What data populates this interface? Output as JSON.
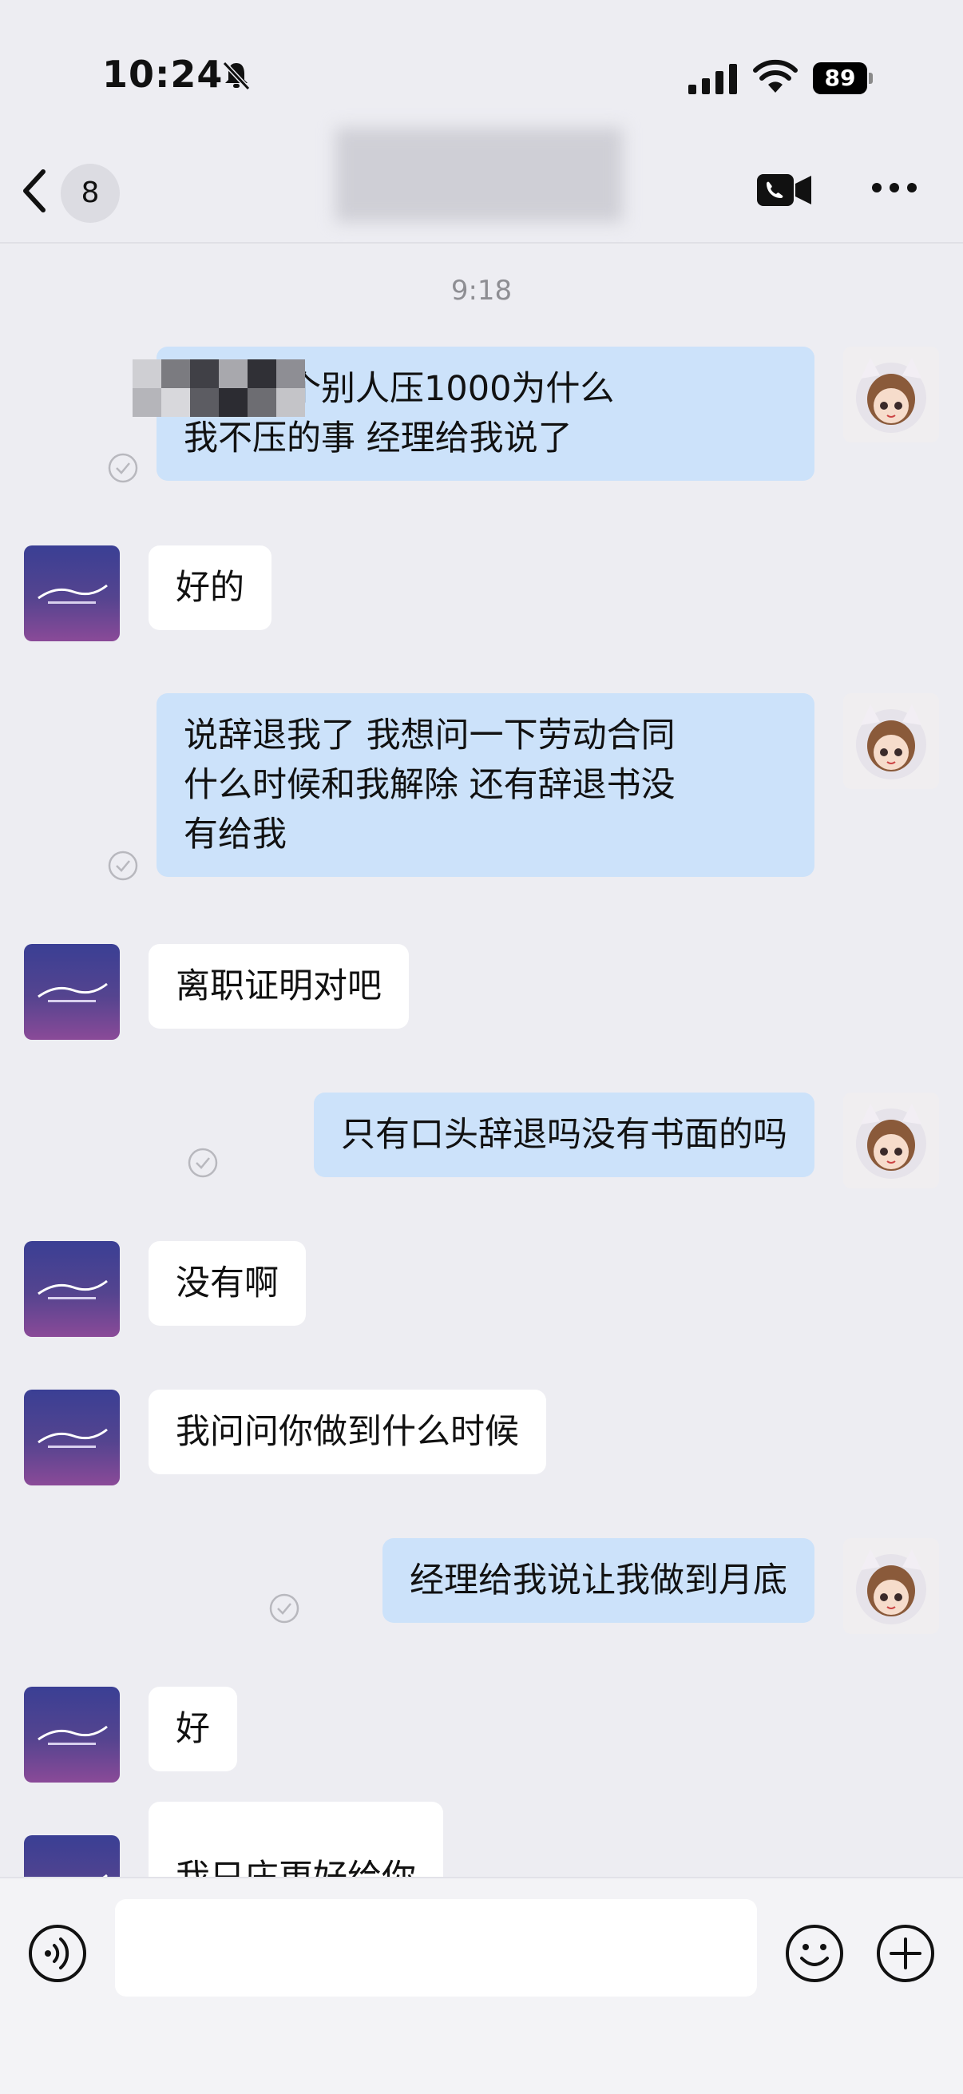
{
  "status": {
    "time": "10:24",
    "battery": "89"
  },
  "nav": {
    "unread_count": "8"
  },
  "chat": {
    "timestamp": "9:18",
    "messages": [
      {
        "side": "me",
        "text": "关于那个别人压1000为什么\n我不压的事 经理给我说了"
      },
      {
        "side": "them",
        "text": "好的"
      },
      {
        "side": "me",
        "text": "说辞退我了 我想问一下劳动合同\n什么时候和我解除 还有辞退书没\n有给我"
      },
      {
        "side": "them",
        "text": "离职证明对吧"
      },
      {
        "side": "me",
        "text": "只有口头辞退吗没有书面的吗"
      },
      {
        "side": "them",
        "text": "没有啊"
      },
      {
        "side": "them",
        "text": "我问问你做到什么时候"
      },
      {
        "side": "me",
        "text": "经理给我说让我做到月底"
      },
      {
        "side": "them",
        "text": "好"
      },
      {
        "side": "them",
        "text": "我只庄更好给你"
      }
    ]
  },
  "input": {
    "placeholder": ""
  },
  "colors": {
    "me_bubble": "#CCE2FA",
    "them_bubble": "#FFFFFF",
    "background": "#EDEDF2"
  }
}
